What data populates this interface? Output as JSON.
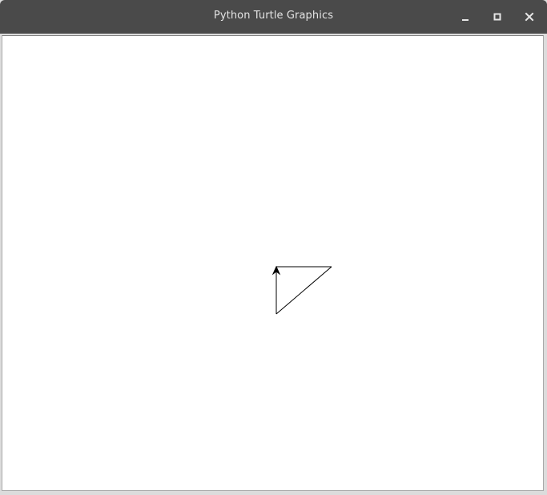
{
  "window": {
    "title": "Python Turtle Graphics",
    "controls": {
      "minimize_icon": "minimize-icon",
      "maximize_icon": "maximize-icon",
      "close_icon": "close-icon"
    }
  },
  "canvas": {
    "background": "#ffffff",
    "pen_color": "#000000",
    "turtle_shape": "classic-arrow"
  }
}
